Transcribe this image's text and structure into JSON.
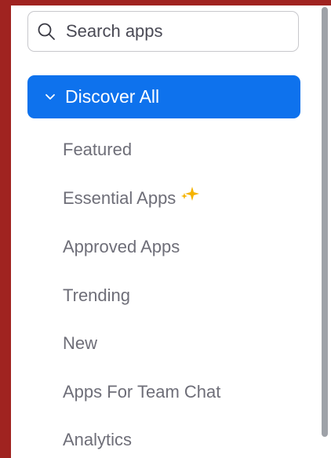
{
  "search": {
    "placeholder": "Search apps",
    "value": ""
  },
  "nav": {
    "discover_label": "Discover All",
    "items": [
      {
        "label": "Featured"
      },
      {
        "label": "Essential Apps",
        "badge_icon": "sparkle-icon"
      },
      {
        "label": "Approved Apps"
      },
      {
        "label": "Trending"
      },
      {
        "label": "New"
      },
      {
        "label": "Apps For Team Chat"
      },
      {
        "label": "Analytics"
      }
    ]
  },
  "colors": {
    "accent": "#0e72ed",
    "sparkle": "#f5b300",
    "frame": "#a02320",
    "item_text": "#6e6e78"
  }
}
